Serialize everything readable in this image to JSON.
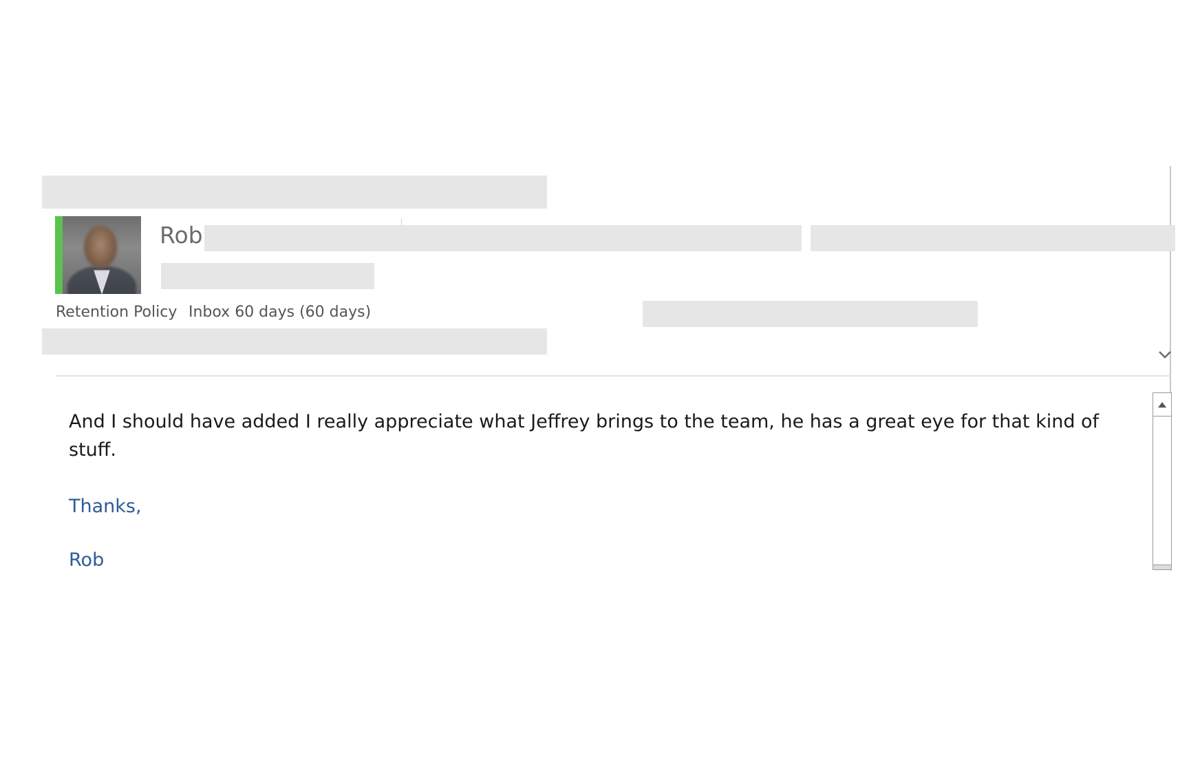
{
  "message": {
    "sender_name": "Rob",
    "retention_label": "Retention Policy",
    "retention_value": "Inbox 60 days (60 days)",
    "body": "And I should have added I really appreciate what Jeffrey brings to the team, he has a great eye for that kind of stuff.",
    "closing": "Thanks,",
    "signature": "Rob"
  },
  "icons": {
    "expand": "chevron-down-icon",
    "scroll_up": "scroll-up-arrow-icon"
  },
  "colors": {
    "presence": "#5bc24f",
    "signature": "#2e5b97",
    "redaction": "#e6e6e6"
  }
}
